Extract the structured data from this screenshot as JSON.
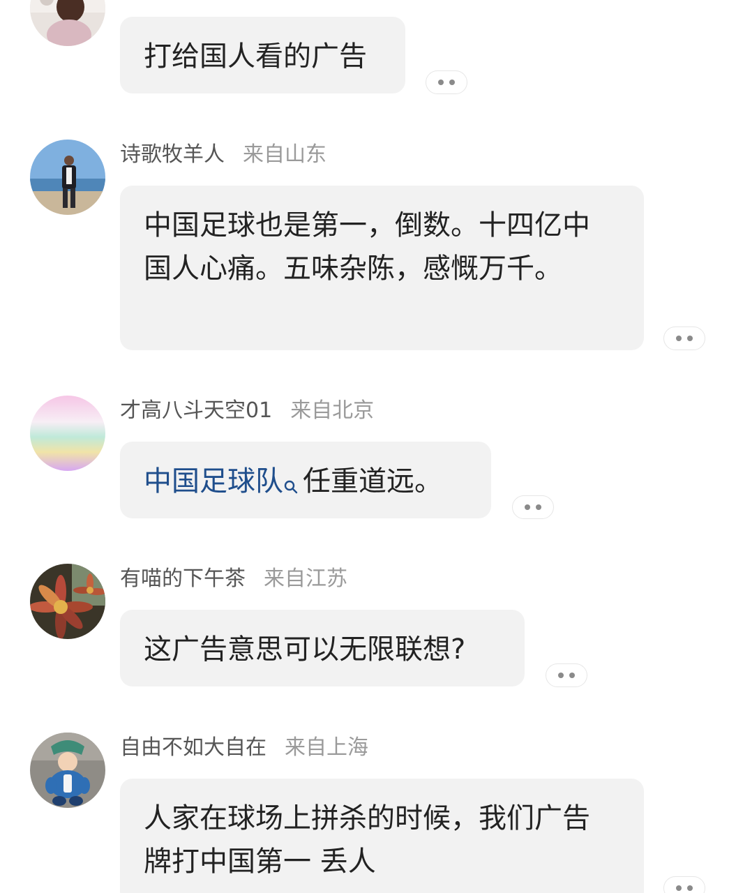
{
  "comments": [
    {
      "username": "",
      "location": "",
      "text": "打给国人看的广告",
      "avatar_icon": "child-photo-avatar"
    },
    {
      "username": "诗歌牧羊人",
      "location": "来自山东",
      "text": "中国足球也是第一，倒数。十四亿中国人心痛。五味杂陈，感慨万千。",
      "avatar_icon": "beach-man-photo-avatar"
    },
    {
      "username": "才高八斗天空01",
      "location": "来自北京",
      "link_text": "中国足球队",
      "text": "任重道远。",
      "avatar_icon": "gradient-avatar"
    },
    {
      "username": "有喵的下午茶",
      "location": "来自江苏",
      "text": "这广告意思可以无限联想?",
      "avatar_icon": "succulent-plant-avatar"
    },
    {
      "username": "自由不如大自在",
      "location": "来自上海",
      "text": "人家在球场上拼杀的时候，我们广告牌打中国第一 丢人",
      "avatar_icon": "cartoon-figure-avatar"
    }
  ],
  "colors": {
    "bubble_bg": "#f2f2f2",
    "text": "#222222",
    "username": "#555555",
    "location": "#9a9a9a",
    "link": "#1f4e8c"
  }
}
